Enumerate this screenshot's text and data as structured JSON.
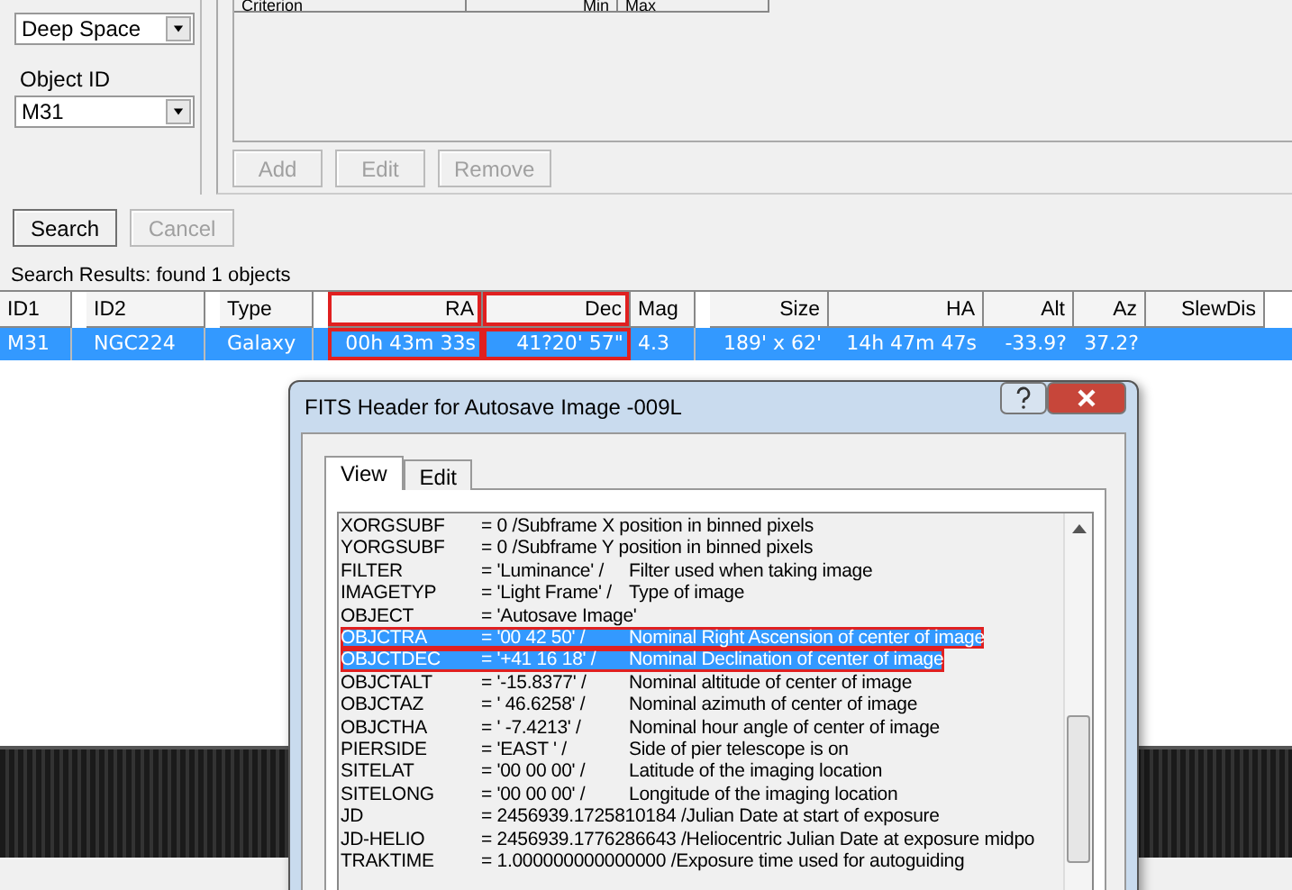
{
  "search_panel": {
    "category": {
      "value": "Deep Space"
    },
    "object_id_label": "Object ID",
    "object_id": {
      "value": "M31"
    }
  },
  "criteria": {
    "columns": [
      "Criterion",
      "Min",
      "Max"
    ],
    "buttons": [
      {
        "label": "Add",
        "disabled": true
      },
      {
        "label": "Edit",
        "disabled": true
      },
      {
        "label": "Remove",
        "disabled": true
      }
    ]
  },
  "actions": [
    {
      "label": "Search",
      "disabled": false
    },
    {
      "label": "Cancel",
      "disabled": true
    }
  ],
  "results": {
    "caption": "Search Results: found 1 objects",
    "columns": [
      {
        "label": "ID1",
        "marked": false
      },
      {
        "label": "ID2",
        "marked": false
      },
      {
        "label": "Type",
        "marked": false
      },
      {
        "label": "RA",
        "marked": true
      },
      {
        "label": "Dec",
        "marked": true
      },
      {
        "label": "Mag",
        "marked": false
      },
      {
        "label": "Size",
        "marked": false
      },
      {
        "label": "HA",
        "marked": false
      },
      {
        "label": "Alt",
        "marked": false
      },
      {
        "label": "Az",
        "marked": false
      },
      {
        "label": "SlewDis",
        "marked": false
      }
    ],
    "rows": [
      {
        "selected": true,
        "cells": [
          "M31",
          "NGC224",
          "Galaxy",
          "00h 43m 33s",
          "41?20' 57\"",
          "4.3",
          "189' x 62'",
          "14h 47m 47s",
          "-33.9?",
          "37.2?",
          ""
        ]
      }
    ]
  },
  "dialog": {
    "title": "FITS Header for Autosave Image -009L",
    "tabs": [
      {
        "label": "View",
        "selected": true
      },
      {
        "label": "Edit",
        "selected": false
      }
    ],
    "lines": [
      {
        "keyword": "XORGSUBF",
        "value": "= 0 /Subframe X position in binned pixels",
        "selected": false,
        "marked": false
      },
      {
        "keyword": "YORGSUBF",
        "value": "= 0 /Subframe Y position in binned pixels",
        "selected": false,
        "marked": false
      },
      {
        "keyword": "FILTER",
        "value": "= 'Luminance' /",
        "comment": "Filter used when taking image",
        "selected": false,
        "marked": false
      },
      {
        "keyword": "IMAGETYP",
        "value": "= 'Light Frame' /",
        "comment": "Type of image",
        "selected": false,
        "marked": false
      },
      {
        "keyword": "OBJECT",
        "value": "= 'Autosave Image'",
        "selected": false,
        "marked": false
      },
      {
        "keyword": "OBJCTRA",
        "value": "= '00 42 50' /",
        "comment": "Nominal Right Ascension of center of image",
        "selected": true,
        "marked": true
      },
      {
        "keyword": "OBJCTDEC",
        "value": "= '+41 16 18' /",
        "comment": "Nominal Declination of center of image",
        "selected": true,
        "marked": true
      },
      {
        "keyword": "OBJCTALT",
        "value": "= '-15.8377' /",
        "comment": "Nominal altitude of center of image",
        "selected": false,
        "marked": false
      },
      {
        "keyword": "OBJCTAZ",
        "value": "= ' 46.6258' /",
        "comment": "Nominal azimuth of center of image",
        "selected": false,
        "marked": false
      },
      {
        "keyword": "OBJCTHA",
        "value": "= ' -7.4213' /",
        "comment": "Nominal hour angle of center of image",
        "selected": false,
        "marked": false
      },
      {
        "keyword": "PIERSIDE",
        "value": "= 'EAST    ' /",
        "comment": "Side of pier telescope is on",
        "selected": false,
        "marked": false
      },
      {
        "keyword": "SITELAT",
        "value": "= '00 00 00' /",
        "comment": "Latitude of the imaging location",
        "selected": false,
        "marked": false
      },
      {
        "keyword": "SITELONG",
        "value": "= '00 00 00' /",
        "comment": "Longitude of the imaging location",
        "selected": false,
        "marked": false
      },
      {
        "keyword": "JD",
        "value": "= 2456939.1725810184 /Julian Date at start of exposure",
        "selected": false,
        "marked": false
      },
      {
        "keyword": "JD-HELIO",
        "value": "= 2456939.1776286643 /Heliocentric Julian Date at exposure midpo",
        "selected": false,
        "marked": false
      },
      {
        "keyword": "TRAKTIME",
        "value": "= 1.000000000000000 /Exposure time used for autoguiding",
        "selected": false,
        "marked": false
      }
    ]
  }
}
